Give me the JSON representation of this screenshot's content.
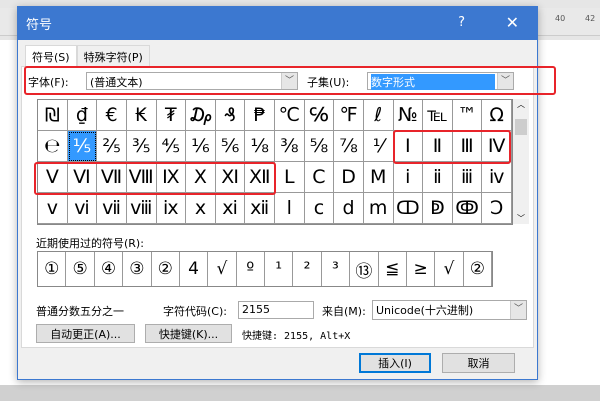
{
  "ruler": [
    "40",
    "42"
  ],
  "dialog": {
    "title": "符号",
    "help": "?",
    "close": "✕"
  },
  "tabs": [
    "符号(S)",
    "特殊字符(P)"
  ],
  "font": {
    "label": "字体(F):",
    "value": "(普通文本)"
  },
  "subset": {
    "label": "子集(U):",
    "value": "数字形式"
  },
  "symbols": [
    "₪",
    "₫",
    "€",
    "₭",
    "₮",
    "₯",
    "₰",
    "₱",
    "℃",
    "℅",
    "℉",
    "ℓ",
    "№",
    "℡",
    "™",
    "Ω",
    "℮",
    "⅕",
    "⅖",
    "⅗",
    "⅘",
    "⅙",
    "⅚",
    "⅛",
    "⅜",
    "⅝",
    "⅞",
    "⅟",
    "Ⅰ",
    "Ⅱ",
    "Ⅲ",
    "Ⅳ",
    "Ⅴ",
    "Ⅵ",
    "Ⅶ",
    "Ⅷ",
    "Ⅸ",
    "Ⅹ",
    "Ⅺ",
    "Ⅻ",
    "Ⅼ",
    "Ⅽ",
    "Ⅾ",
    "Ⅿ",
    "ⅰ",
    "ⅱ",
    "ⅲ",
    "ⅳ",
    "ⅴ",
    "ⅵ",
    "ⅶ",
    "ⅷ",
    "ⅸ",
    "ⅹ",
    "ⅺ",
    "ⅻ",
    "ⅼ",
    "ⅽ",
    "ⅾ",
    "ⅿ",
    "ↀ",
    "ↁ",
    "ↂ",
    "Ↄ"
  ],
  "selected_index": 17,
  "recent": {
    "label": "近期使用过的符号(R):",
    "items": [
      "①",
      "⑤",
      "④",
      "③",
      "②",
      "4",
      "√",
      "º",
      "¹",
      "²",
      "³",
      "⑬",
      "≦",
      "≥",
      "√",
      "②"
    ]
  },
  "char_name": "普通分数五分之一",
  "char_code": {
    "label": "字符代码(C):",
    "value": "2155"
  },
  "from": {
    "label": "来自(M):",
    "value": "Unicode(十六进制)"
  },
  "buttons": {
    "autocorrect": "自动更正(A)...",
    "shortcut_key": "快捷键(K)...",
    "insert": "插入(I)",
    "cancel": "取消"
  },
  "shortcut_text": "快捷键: 2155, Alt+X",
  "colors": {
    "titlebar": "#3c78d0",
    "highlight": "#e8242a",
    "selection": "#3399ff"
  }
}
